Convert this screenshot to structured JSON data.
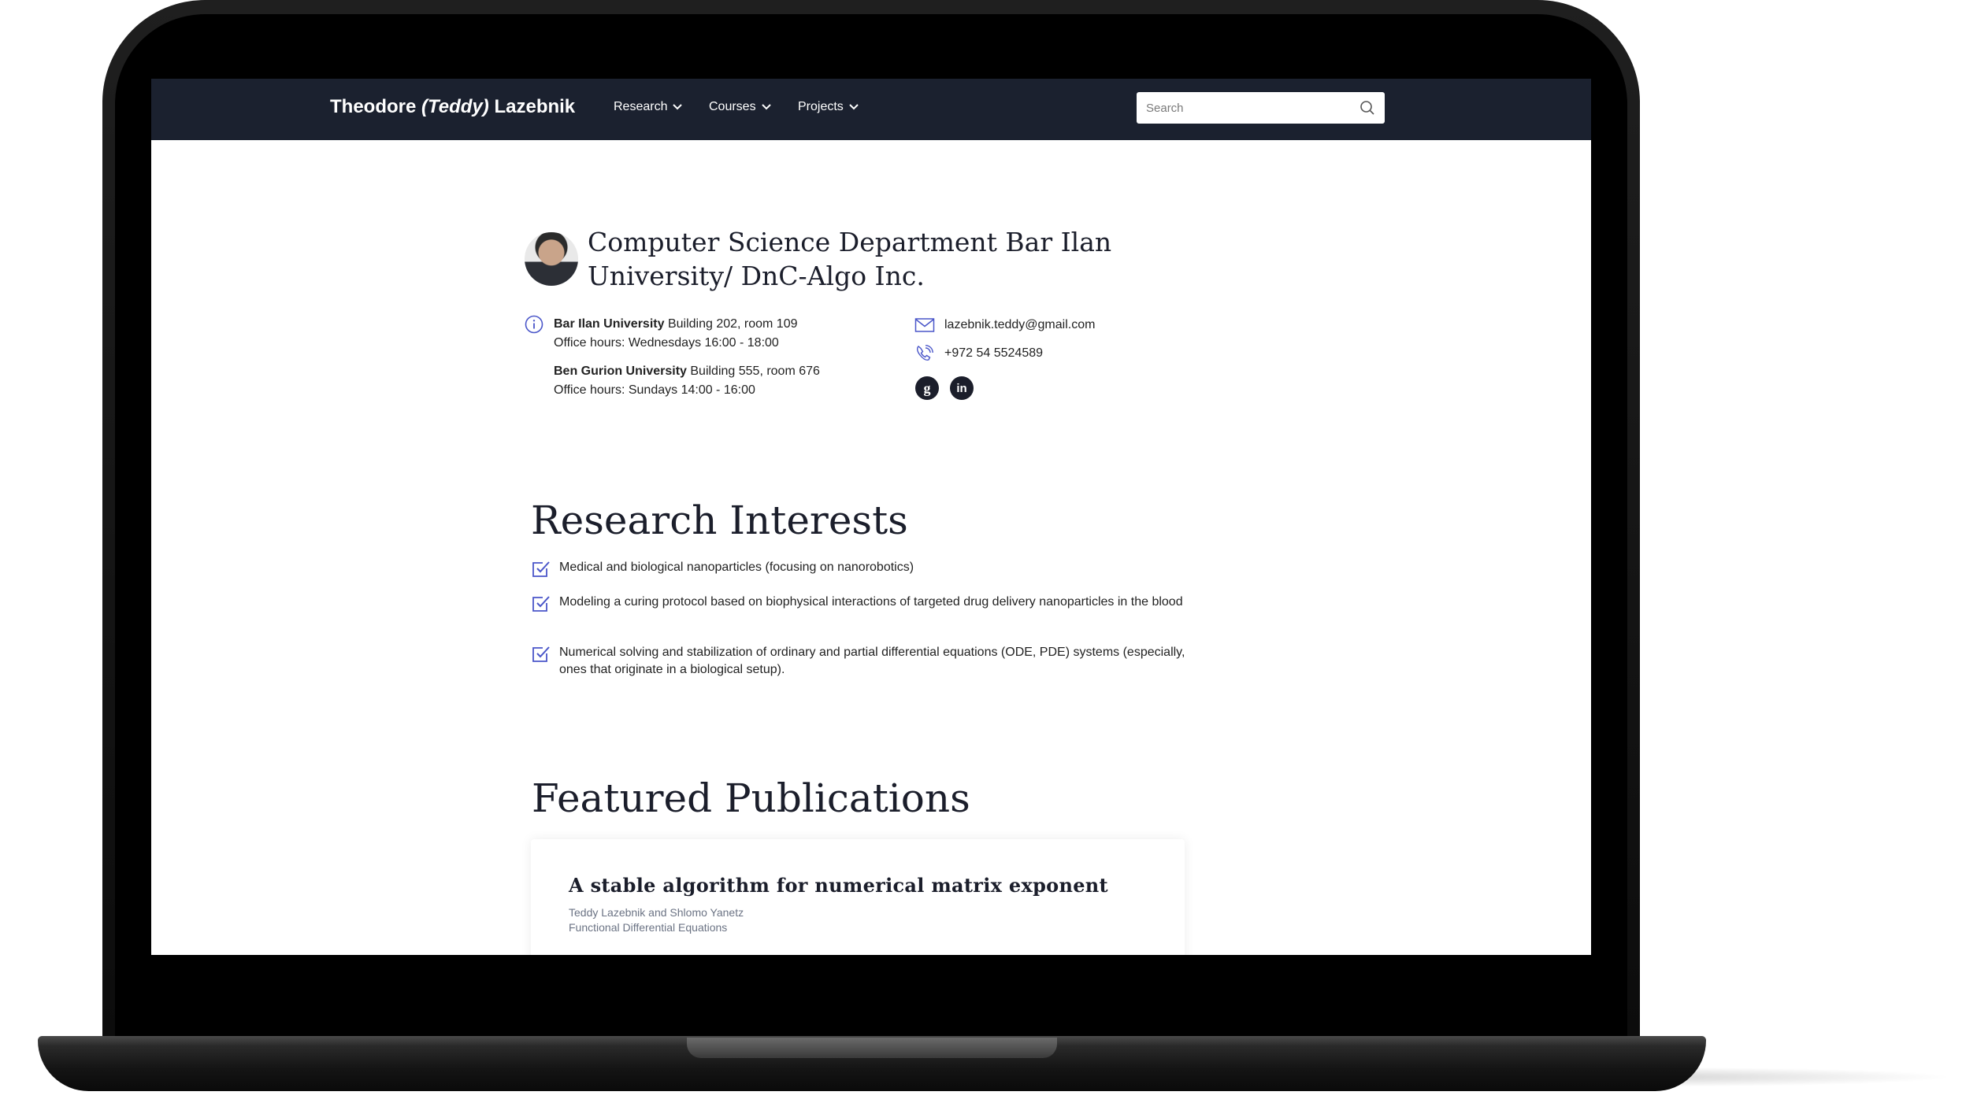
{
  "navbar": {
    "brand_first": "Theodore ",
    "brand_nick": "(Teddy)",
    "brand_last": " Lazebnik",
    "menu": [
      "Research",
      "Courses",
      "Projects"
    ],
    "search_placeholder": "Search"
  },
  "profile": {
    "affiliation": "Computer Science Department Bar Ilan University/ DnC-Algo Inc.",
    "offices": [
      {
        "name": "Bar Ilan University",
        "location": " Building 202, room 109",
        "hours": "Office hours: Wednesdays 16:00 - 18:00"
      },
      {
        "name": "Ben Gurion University",
        "location": " Building 555, room 676",
        "hours": "Office hours: Sundays 14:00 - 16:00"
      }
    ],
    "email": "lazebnik.teddy@gmail.com",
    "phone": "+972 54 5524589",
    "social_icons": [
      "google-scholar-icon",
      "linkedin-icon"
    ]
  },
  "research": {
    "title": "Research Interests",
    "items": [
      "Medical and biological nanoparticles (focusing on nanorobotics)",
      "Modeling a curing protocol based on biophysical interactions of targeted drug delivery nanoparticles in the blood",
      "Numerical solving and stabilization of ordinary and partial differential equations (ODE, PDE) systems (especially, ones that originate in a biological setup)."
    ]
  },
  "publications": {
    "title": "Featured Publications",
    "items": [
      {
        "title": "A stable algorithm for numerical matrix exponent",
        "authors": "Teddy Lazebnik and Shlomo Yanetz",
        "venue": "Functional Differential Equations"
      }
    ]
  },
  "colors": {
    "navbar": "#1b212f",
    "accent": "#4a56c9",
    "text": "#1b1e2b"
  }
}
